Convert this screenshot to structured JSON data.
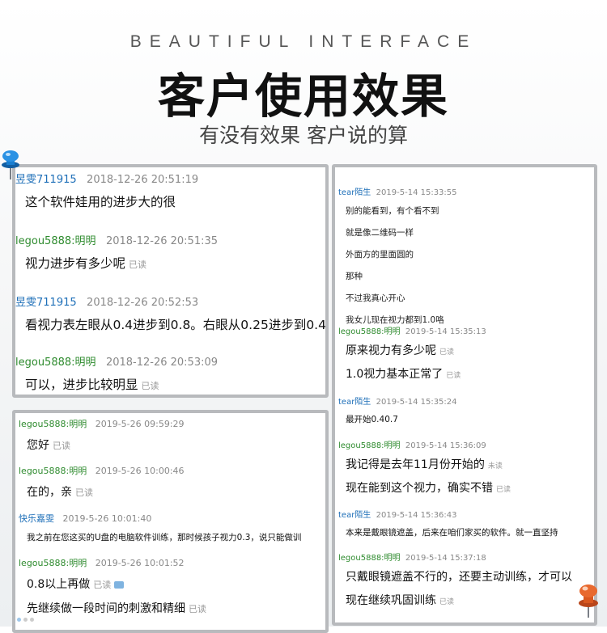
{
  "header": {
    "eyebrow": "BEAUTIFUL INTERFACE",
    "title": "客户使用效果",
    "subtitle": "有没有效果 客户说的算"
  },
  "colors": {
    "panel_border": "#b8babd",
    "name_blue": "#1e6fb8",
    "name_green": "#2e8b2e",
    "meta_gray": "#888888",
    "pin_blue": "#1a7fd1",
    "pin_orange": "#e8692e"
  },
  "read_label": "已读",
  "unread_label": "未读",
  "panel1": {
    "m1": {
      "name": "昱雯711915",
      "time": "2018-12-26 20:51:19",
      "text": "这个软件娃用的进步大的很"
    },
    "m2": {
      "name": "legou5888:明明",
      "time": "2018-12-26 20:51:35",
      "text": "视力进步有多少呢"
    },
    "m3": {
      "name": "昱雯711915",
      "time": "2018-12-26 20:52:53",
      "text": "看视力表左眼从0.4进步到0.8。右眼从0.25进步到0.4"
    },
    "m4": {
      "name": "legou5888:明明",
      "time": "2018-12-26 20:53:09",
      "text": "可以，进步比较明显"
    }
  },
  "panel2": {
    "m1": {
      "name": "legou5888:明明",
      "time": "2019-5-26 09:59:29",
      "text": "您好"
    },
    "m2": {
      "name": "legou5888:明明",
      "time": "2019-5-26 10:00:46",
      "text": "在的，亲"
    },
    "m3": {
      "name": "快乐嘉雯",
      "time": "2019-5-26 10:01:40",
      "text": "我之前在您这买的U盘的电脑软件训练，那时候孩子视力0.3，说只能做训"
    },
    "m4": {
      "name": "legou5888:明明",
      "time": "2019-5-26 10:01:52",
      "text1": "0.8以上再做",
      "text2": "先继续做一段时间的刺激和精细"
    }
  },
  "panel3": {
    "m1": {
      "name": "tear陌生",
      "time": "2019-5-14 15:33:55",
      "lines": [
        "别的能看到，有个看不到",
        "就是像二维码一样",
        "外面方的里面圆的",
        "那种",
        "不过我真心开心",
        "我女儿现在视力都到1.0咯"
      ]
    },
    "m2": {
      "name": "legou5888:明明",
      "time": "2019-5-14 15:35:13",
      "text1": "原来视力有多少呢",
      "text2": "1.0视力基本正常了"
    },
    "m3": {
      "name": "tear陌生",
      "time": "2019-5-14 15:35:24",
      "text": "最开始0.40.7"
    },
    "m4": {
      "name": "legou5888:明明",
      "time": "2019-5-14 15:36:09",
      "text1": "我记得是去年11月份开始的",
      "text2": "现在能到这个视力，确实不错"
    },
    "m5": {
      "name": "tear陌生",
      "time": "2019-5-14 15:36:43",
      "text": "本来是戴眼镜遮盖，后来在咱们家买的软件。就一直坚持"
    },
    "m6": {
      "name": "legou5888:明明",
      "time": "2019-5-14 15:37:18",
      "text1": "只戴眼镜遮盖不行的，还要主动训练，才可以",
      "text2": "现在继续巩固训练"
    }
  }
}
